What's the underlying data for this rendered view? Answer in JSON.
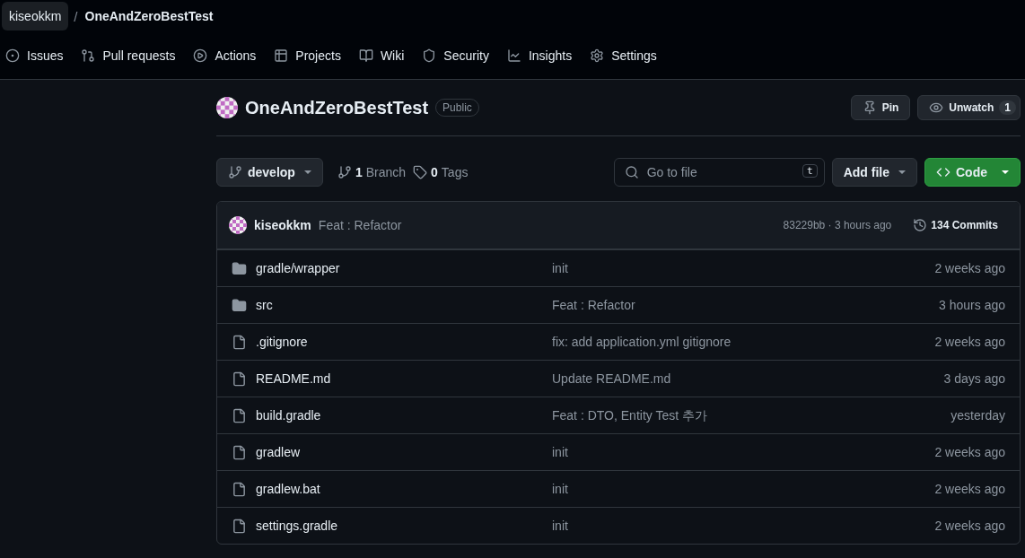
{
  "breadcrumb": {
    "owner": "kiseokkm",
    "separator": "/",
    "repo": "OneAndZeroBestTest"
  },
  "nav": [
    {
      "kind": "issues",
      "label": "Issues"
    },
    {
      "kind": "pulls",
      "label": "Pull requests"
    },
    {
      "kind": "actions",
      "label": "Actions"
    },
    {
      "kind": "projects",
      "label": "Projects"
    },
    {
      "kind": "wiki",
      "label": "Wiki"
    },
    {
      "kind": "security",
      "label": "Security"
    },
    {
      "kind": "insights",
      "label": "Insights"
    },
    {
      "kind": "settings",
      "label": "Settings"
    }
  ],
  "repo": {
    "name": "OneAndZeroBestTest",
    "visibility": "Public",
    "pin": "Pin",
    "unwatch": "Unwatch",
    "watch_count": "1"
  },
  "toolbar": {
    "branch": "develop",
    "branches_count": "1",
    "branches_label": "Branch",
    "tags_count": "0",
    "tags_label": "Tags",
    "search_placeholder": "Go to file",
    "search_key": "t",
    "add_file": "Add file",
    "code": "Code"
  },
  "commit": {
    "author": "kiseokkm",
    "message": "Feat : Refactor",
    "meta": "83229bb · 3 hours ago",
    "commits": "134 Commits"
  },
  "files": [
    {
      "kind": "folder",
      "name": "gradle/wrapper",
      "message": "init",
      "age": "2 weeks ago"
    },
    {
      "kind": "folder",
      "name": "src",
      "message": "Feat : Refactor",
      "age": "3 hours ago"
    },
    {
      "kind": "file",
      "name": ".gitignore",
      "message": "fix: add application.yml gitignore",
      "age": "2 weeks ago"
    },
    {
      "kind": "file",
      "name": "README.md",
      "message": "Update README.md",
      "age": "3 days ago"
    },
    {
      "kind": "file",
      "name": "build.gradle",
      "message": "Feat : DTO, Entity Test 추가",
      "age": "yesterday"
    },
    {
      "kind": "file",
      "name": "gradlew",
      "message": "init",
      "age": "2 weeks ago"
    },
    {
      "kind": "file",
      "name": "gradlew.bat",
      "message": "init",
      "age": "2 weeks ago"
    },
    {
      "kind": "file",
      "name": "settings.gradle",
      "message": "init",
      "age": "2 weeks ago"
    }
  ]
}
